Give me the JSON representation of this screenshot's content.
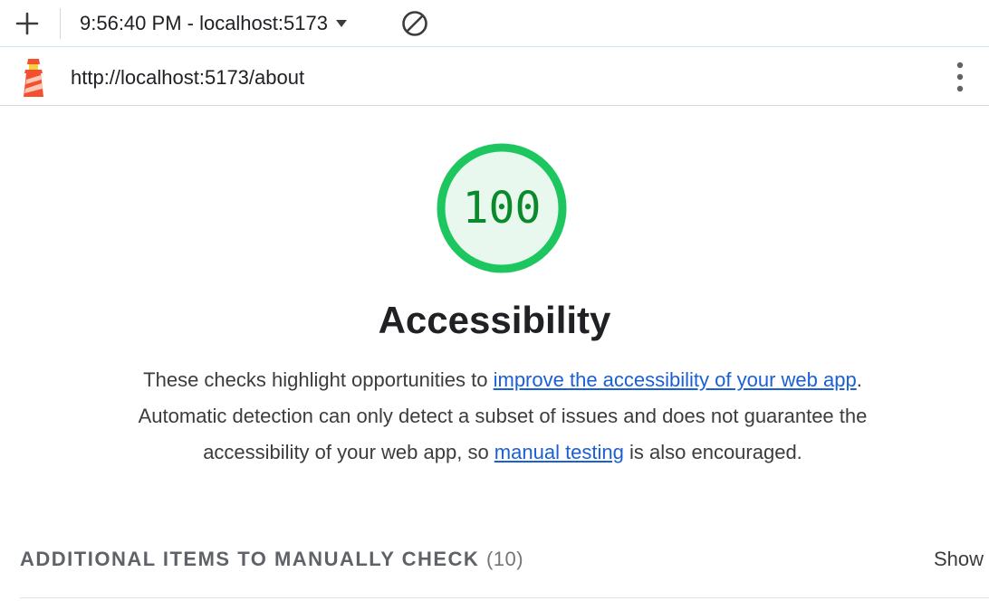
{
  "toolbar": {
    "add_icon": "plus-icon",
    "report_label": "9:56:40 PM - localhost:5173",
    "dropdown_icon": "caret-down-icon",
    "clear_icon": "block-icon"
  },
  "urlbar": {
    "logo_icon": "lighthouse-icon",
    "url": "http://localhost:5173/about",
    "menu_icon": "kebab-menu-icon"
  },
  "category": {
    "score": "100",
    "title": "Accessibility",
    "description": {
      "part1": "These checks highlight opportunities to ",
      "link1": "improve the accessibility of your web app",
      "part2": ". Automatic detection can only detect a subset of issues and does not guarantee the accessibility of your web app, so ",
      "link2": "manual testing",
      "part3": " is also encouraged."
    }
  },
  "manual_section": {
    "title": "ADDITIONAL ITEMS TO MANUALLY CHECK",
    "count": "(10)",
    "toggle_label": "Show"
  },
  "colors": {
    "gauge_ring": "#1ec660",
    "gauge_fill": "#e8f8ee",
    "gauge_text": "#0a8a2a",
    "link": "#1a5fd6",
    "logo_red": "#f4502f",
    "logo_yellow": "#fbd13b"
  }
}
